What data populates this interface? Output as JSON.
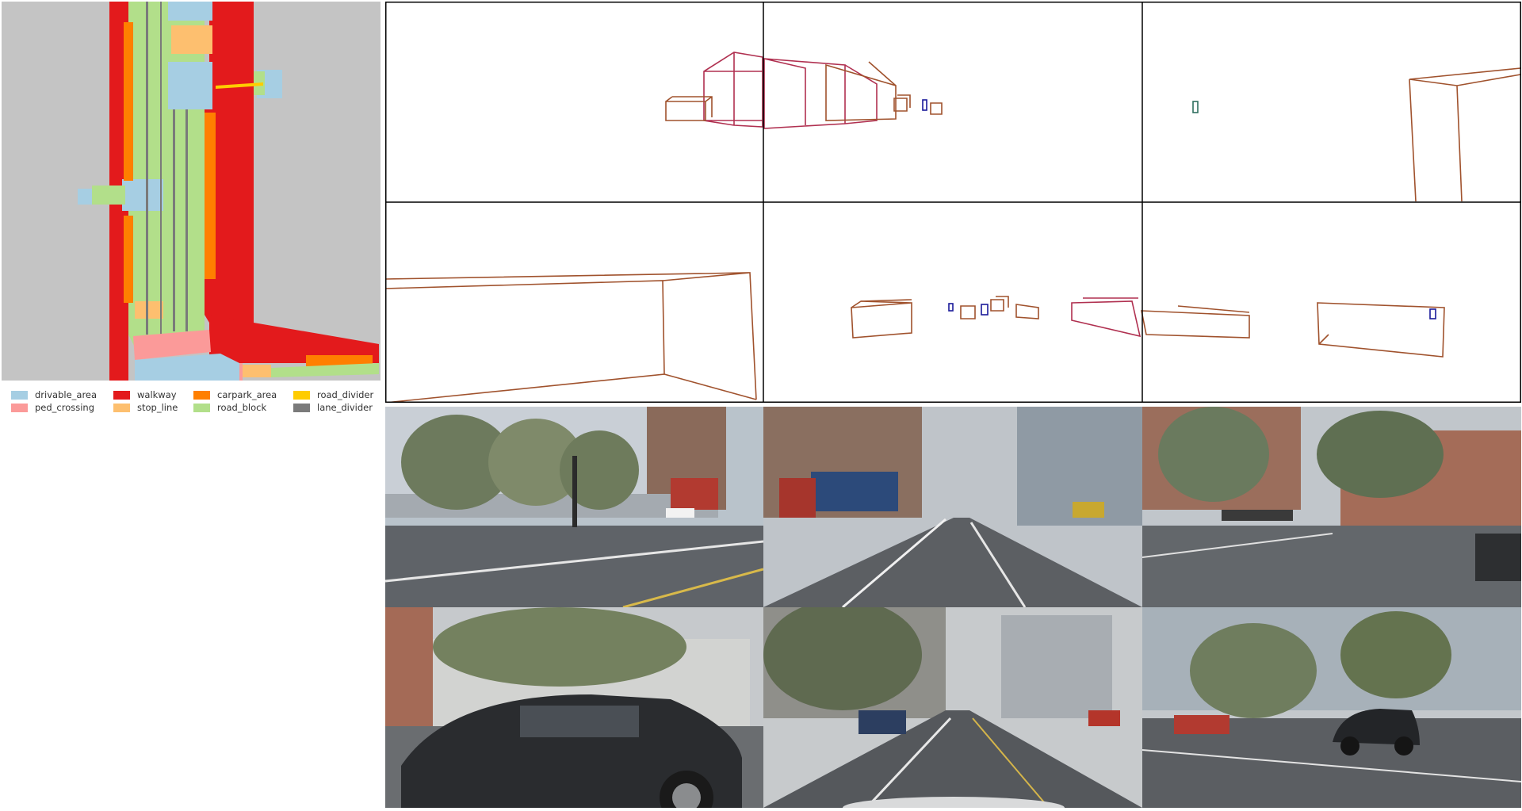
{
  "bev_map": {
    "colors": {
      "background": "#c4c4c4",
      "drivable_area": "#a6cee3",
      "ped_crossing": "#fb9a99",
      "walkway": "#e31a1c",
      "stop_line": "#fdbf6f",
      "carpark_area": "#ff7f00",
      "road_divider": "#ffcc00",
      "road_block": "#b2df8a",
      "lane_divider": "#7a7a7a"
    }
  },
  "legend": [
    {
      "label": "drivable_area",
      "color": "#a6cee3"
    },
    {
      "label": "walkway",
      "color": "#e31a1c"
    },
    {
      "label": "carpark_area",
      "color": "#ff7f00"
    },
    {
      "label": "road_divider",
      "color": "#ffcc00"
    },
    {
      "label": "ped_crossing",
      "color": "#fb9a99"
    },
    {
      "label": "stop_line",
      "color": "#fdbf6f"
    },
    {
      "label": "road_block",
      "color": "#b2df8a"
    },
    {
      "label": "lane_divider",
      "color": "#7a7a7a"
    }
  ],
  "box_colors": {
    "car": "#a0522d",
    "truck": "#b03050",
    "pedestrian": "#1a1a9a",
    "barrier": "#2f6f5f"
  },
  "camera_views": [
    {
      "view": "front-left"
    },
    {
      "view": "front"
    },
    {
      "view": "front-right"
    },
    {
      "view": "back-left"
    },
    {
      "view": "back"
    },
    {
      "view": "back-right"
    }
  ]
}
